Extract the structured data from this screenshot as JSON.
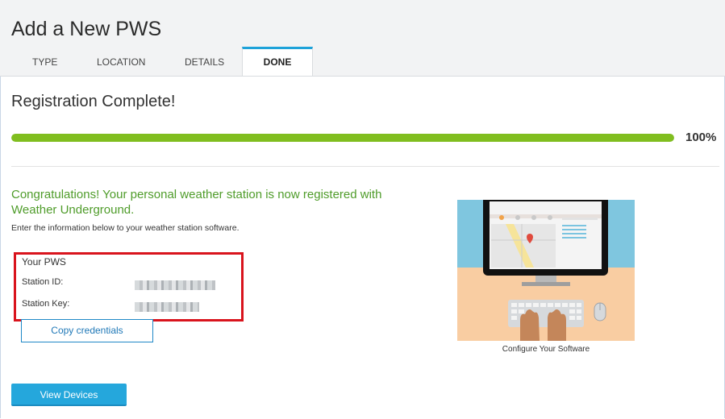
{
  "page": {
    "title": "Add a New PWS",
    "tabs": [
      "TYPE",
      "LOCATION",
      "DETAILS",
      "DONE"
    ],
    "active_tab": "DONE"
  },
  "registration": {
    "title": "Registration Complete!",
    "progress_percent": 100,
    "progress_label": "100%",
    "success_message": "Congratulations! Your personal weather station is now registered with Weather Underground.",
    "instructions": "Enter the information below to your weather station software."
  },
  "pws": {
    "title": "Your PWS",
    "station_id_label": "Station ID:",
    "station_key_label": "Station Key:"
  },
  "buttons": {
    "copy": "Copy credentials",
    "view_devices": "View Devices"
  },
  "illustration": {
    "caption": "Configure Your Software"
  },
  "colors": {
    "progress": "#80be1f",
    "accent": "#25a7dc",
    "success_text": "#4f9c2a",
    "highlight_box": "#d9141d"
  }
}
